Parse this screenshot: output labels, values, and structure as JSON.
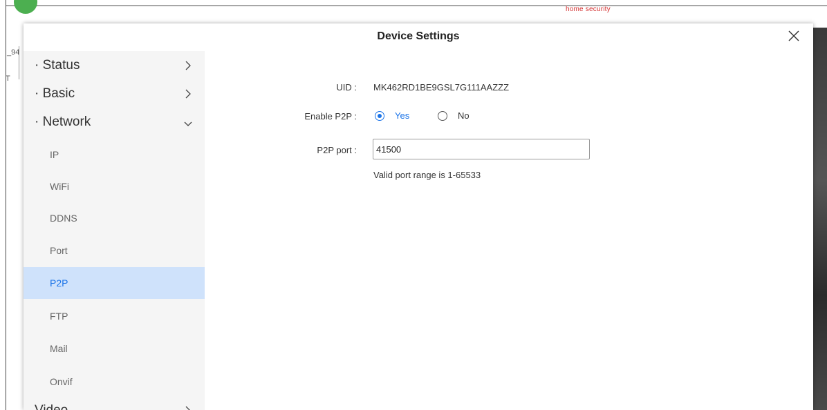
{
  "background": {
    "brand_text": "home security",
    "left_text_1": "_94",
    "left_text_2": "T"
  },
  "dialog": {
    "title": "Device Settings",
    "close_icon": "close-icon"
  },
  "sidebar": {
    "groups": [
      {
        "label": "· Status",
        "chevron": "chevron-right-icon"
      },
      {
        "label": "· Basic",
        "chevron": "chevron-right-icon"
      },
      {
        "label": "· Network",
        "chevron": "chevron-down-icon"
      },
      {
        "label": "Video",
        "chevron": "chevron-right-icon"
      }
    ],
    "network_items": [
      {
        "label": "IP"
      },
      {
        "label": "WiFi"
      },
      {
        "label": "DDNS"
      },
      {
        "label": "Port"
      },
      {
        "label": "P2P",
        "active": true
      },
      {
        "label": "FTP"
      },
      {
        "label": "Mail"
      },
      {
        "label": "Onvif"
      }
    ]
  },
  "form": {
    "uid_label": "UID :",
    "uid_value": "MK462RD1BE9GSL7G111AAZZZ",
    "enable_label": "Enable P2P :",
    "yes_label": "Yes",
    "no_label": "No",
    "enable_p2p": "Yes",
    "port_label": "P2P port :",
    "port_value": "41500",
    "port_hint": "Valid port range is 1-65533"
  },
  "colors": {
    "accent": "#1a73e8",
    "active_bg": "#cfe2fb",
    "sidebar_bg": "#f5f5f5"
  }
}
